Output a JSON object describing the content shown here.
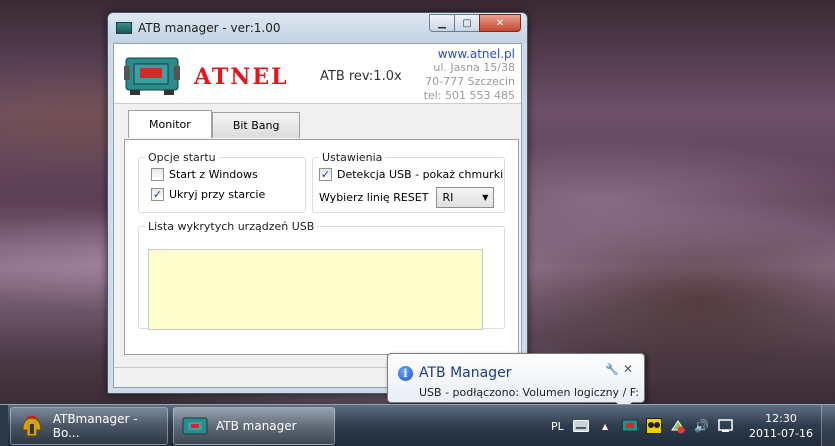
{
  "window": {
    "title": "ATB manager - ver:1.00",
    "minimize_glyph": "▁",
    "maximize_glyph": "▢",
    "close_glyph": "✕"
  },
  "header": {
    "logo_text": "ATNEL",
    "rev_text": "ATB rev:1.0x",
    "url": "www.atnel.pl",
    "address_line1": "ul. Jasna 15/38",
    "address_line2": "70-777 Szczecin",
    "phone": "tel: 501 553 485"
  },
  "tabs": [
    {
      "label": "Monitor",
      "active": true
    },
    {
      "label": "Bit Bang",
      "active": false
    }
  ],
  "startup_options": {
    "legend": "Opcje startu",
    "start_with_windows": {
      "label": "Start z Windows",
      "checked": false
    },
    "hide_on_start": {
      "label": "Ukryj przy starcie",
      "checked": true
    }
  },
  "settings": {
    "legend": "Ustawienia",
    "usb_detection": {
      "label": "Detekcja USB - pokaż chmurki",
      "checked": true
    },
    "reset_line_label": "Wybierz linię RESET",
    "reset_line_value": "RI",
    "dropdown_glyph": "▼"
  },
  "usb_devices": {
    "legend": "Lista wykrytych urządzeń USB",
    "items": []
  },
  "balloon": {
    "info_glyph": "i",
    "title": "ATB Manager",
    "message": "USB - podłączono: Volumen logiczny / F:",
    "pin_glyph": "🔧",
    "close_glyph": "✕"
  },
  "taskbar": {
    "buttons": [
      {
        "label": "ATBmanager - Bo...",
        "active": false
      },
      {
        "label": "ATB manager",
        "active": true
      }
    ],
    "language": "PL",
    "arrow_glyph": "▲",
    "volume_glyph": "🔊",
    "clock_time": "12:30",
    "clock_date": "2011-07-16"
  },
  "colors": {
    "logo_red": "#e8141b",
    "url_blue": "#2b4bd6",
    "usb_list_bg": "#fffecd"
  }
}
